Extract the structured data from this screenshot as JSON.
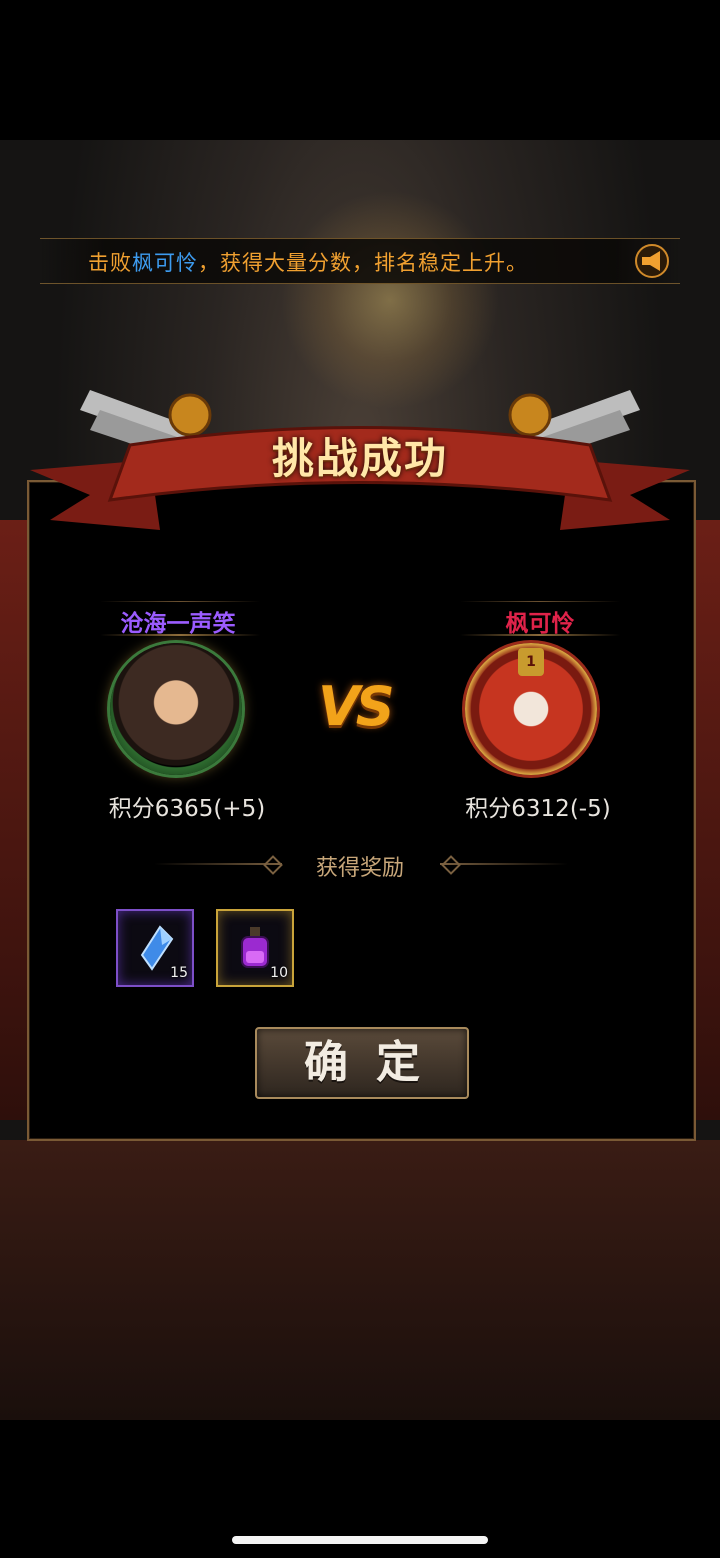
{
  "notice": {
    "prefix": "击败",
    "highlight_name": "枫可怜",
    "suffix": "，获得大量分数，排名稳定上升。",
    "icon": "horn-icon"
  },
  "result": {
    "title": "挑战成功"
  },
  "player_left": {
    "name": "沧海一声笑",
    "name_color": "#9b5cff",
    "score": "积分6365(+5)"
  },
  "versus": {
    "label": "VS"
  },
  "player_right": {
    "name": "枫可怜",
    "name_color": "#e0234a",
    "badge": "1",
    "score": "积分6312(-5)"
  },
  "rewards": {
    "title": "获得奖励",
    "items": [
      {
        "icon": "blue-crystal-icon",
        "qty": "15",
        "frame": "purple"
      },
      {
        "icon": "purple-potion-icon",
        "qty": "10",
        "frame": "gold"
      }
    ]
  },
  "actions": {
    "confirm_label": "确定"
  },
  "colors": {
    "accent_orange": "#f0a030",
    "highlight_blue": "#3d9cf0",
    "panel_border": "#7a5a35"
  }
}
